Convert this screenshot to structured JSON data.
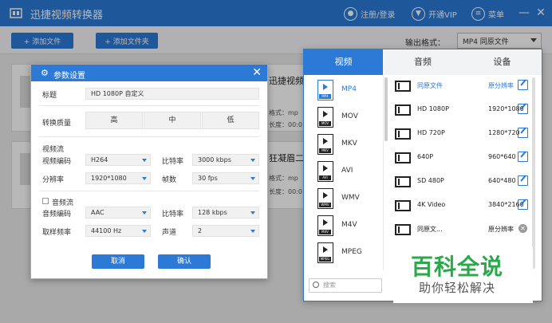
{
  "app": {
    "title": "迅捷视频转换器"
  },
  "header": {
    "login_label": "注册/登录",
    "vip_label": "开通VIP",
    "menu_label": "菜单",
    "minimize_glyph": "—",
    "close_glyph": "✕"
  },
  "toolbar": {
    "add_file_label": "+ 添加文件",
    "add_folder_label": "+ 添加文件夹",
    "output_format_label": "输出格式：",
    "output_format_value": "MP4  同原文件"
  },
  "files": [
    {
      "name": "迅捷视频",
      "format_label": "格式：mp",
      "duration_label": "长度：00:0"
    },
    {
      "name": "狂凝眉二",
      "format_label": "格式：mp",
      "duration_label": "长度：00:0"
    }
  ],
  "dialog": {
    "title": "参数设置",
    "close_glyph": "✕",
    "title_label": "标题",
    "title_value": "HD 1080P 自定义",
    "quality_label": "转换质量",
    "quality_options": [
      "高",
      "中",
      "低"
    ],
    "video_section": "视频流",
    "video_codec_label": "视频编码",
    "video_codec_value": "H264",
    "video_bitrate_label": "比特率",
    "video_bitrate_value": "3000 kbps",
    "resolution_label": "分辨率",
    "resolution_value": "1920*1080",
    "fps_label": "帧数",
    "fps_value": "30 fps",
    "audio_section": "音频流",
    "audio_codec_label": "音频编码",
    "audio_codec_value": "AAC",
    "audio_bitrate_label": "比特率",
    "audio_bitrate_value": "128 kbps",
    "sample_rate_label": "取样频率",
    "sample_rate_value": "44100 Hz",
    "channel_label": "声道",
    "channel_value": "2",
    "cancel_label": "取消",
    "confirm_label": "确认"
  },
  "format_panel": {
    "tabs": [
      "视频",
      "音频",
      "设备"
    ],
    "formats": [
      {
        "name": "MP4",
        "tag": "MP4"
      },
      {
        "name": "MOV",
        "tag": "MOV"
      },
      {
        "name": "MKV",
        "tag": "MKV"
      },
      {
        "name": "AVI",
        "tag": "AVI"
      },
      {
        "name": "WMV",
        "tag": "WMV"
      },
      {
        "name": "M4V",
        "tag": "M4V"
      },
      {
        "name": "MPEG",
        "tag": "MPEG"
      }
    ],
    "search_placeholder": "搜索",
    "presets": [
      {
        "name": "同原文件",
        "resolution": "原分辨率"
      },
      {
        "name": "HD 1080P",
        "resolution": "1920*1080"
      },
      {
        "name": "HD 720P",
        "resolution": "1280*720"
      },
      {
        "name": "640P",
        "resolution": "960*640"
      },
      {
        "name": "SD 480P",
        "resolution": "640*480"
      },
      {
        "name": "4K Video",
        "resolution": "3840*2160"
      },
      {
        "name": "同原文...",
        "resolution": "原分辨率"
      }
    ]
  },
  "watermark": {
    "line1": "百科全说",
    "line2": "助你轻松解决"
  },
  "colors": {
    "accent": "#2c7ad6",
    "watermark_green": "#2aa84a"
  }
}
